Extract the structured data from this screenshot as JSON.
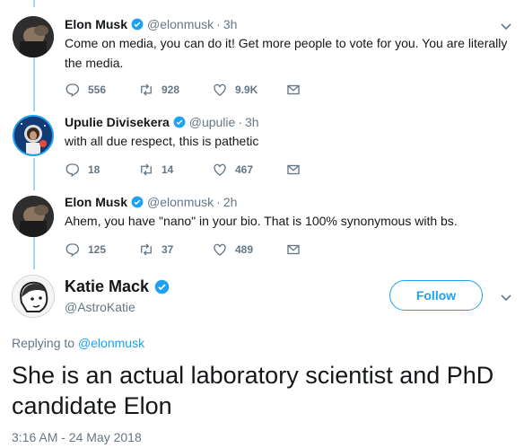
{
  "colors": {
    "accent": "#1da1f2",
    "text": "#14171a",
    "secondary": "#657786",
    "thread": "#a8d6f2"
  },
  "tweets": [
    {
      "name": "Elon Musk",
      "handle": "@elonmusk",
      "time": "3h",
      "text": "Come on media, you can do it! Get more people to vote for you. You are literally the media.",
      "replies": "556",
      "retweets": "928",
      "likes": "9.9K",
      "verified": true
    },
    {
      "name": "Upulie Divisekera",
      "handle": "@upulie",
      "time": "3h",
      "text": "with all due respect, this is pathetic",
      "replies": "18",
      "retweets": "14",
      "likes": "467",
      "verified": true
    },
    {
      "name": "Elon Musk",
      "handle": "@elonmusk",
      "time": "2h",
      "text": "Ahem, you have \"nano\" in your bio. That is 100% synonymous with bs.",
      "replies": "125",
      "retweets": "37",
      "likes": "489",
      "verified": true
    }
  ],
  "main_tweet": {
    "name": "Katie Mack",
    "handle": "@AstroKatie",
    "follow_label": "Follow",
    "replying_prefix": "Replying to",
    "replying_to": "@elonmusk",
    "text": "She is an actual laboratory scientist and PhD candidate Elon",
    "timestamp": "3:16 AM - 24 May 2018",
    "verified": true
  },
  "icons": [
    "reply-icon",
    "retweet-icon",
    "like-icon",
    "message-icon",
    "verified-icon",
    "caret-down-icon"
  ]
}
